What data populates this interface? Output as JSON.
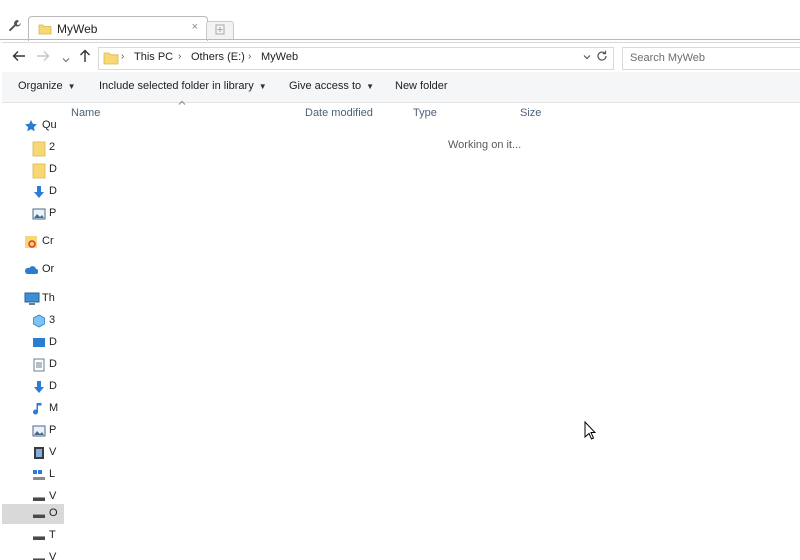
{
  "tab": {
    "title": "MyWeb",
    "close_glyph": "×"
  },
  "breadcrumb": {
    "items": [
      "This PC",
      "Others (E:)",
      "MyWeb"
    ]
  },
  "search": {
    "placeholder": "Search MyWeb"
  },
  "toolbar": {
    "organize": "Organize",
    "include_library": "Include selected folder in library",
    "give_access": "Give access to",
    "new_folder": "New folder"
  },
  "columns": [
    "Name",
    "Date modified",
    "Type",
    "Size"
  ],
  "status": {
    "working": "Working on it..."
  },
  "nav_pane": {
    "items": [
      {
        "label": "Qu",
        "icon": "star-icon"
      },
      {
        "label": "2",
        "icon": "folder-icon"
      },
      {
        "label": "D",
        "icon": "folder-icon"
      },
      {
        "label": "D",
        "icon": "download-icon"
      },
      {
        "label": "P",
        "icon": "pictures-icon"
      },
      {
        "label": "Cr",
        "icon": "creative-cloud-icon"
      },
      {
        "label": "Or",
        "icon": "onedrive-icon"
      },
      {
        "label": "Th",
        "icon": "this-pc-icon"
      },
      {
        "label": "3",
        "icon": "3d-objects-icon"
      },
      {
        "label": "D",
        "icon": "desktop-icon"
      },
      {
        "label": "D",
        "icon": "documents-icon"
      },
      {
        "label": "D",
        "icon": "download-icon"
      },
      {
        "label": "M",
        "icon": "music-icon"
      },
      {
        "label": "P",
        "icon": "pictures-icon"
      },
      {
        "label": "V",
        "icon": "videos-icon"
      },
      {
        "label": "L",
        "icon": "windows-drive-icon"
      },
      {
        "label": "V",
        "icon": "drive-icon"
      },
      {
        "label": "O",
        "icon": "drive-icon"
      },
      {
        "label": "T",
        "icon": "drive-icon"
      },
      {
        "label": "V",
        "icon": "drive-icon"
      }
    ]
  },
  "colors": {
    "accent": "#2b7cd3",
    "folder": "#f8d775",
    "selected": "#d9d9d9",
    "column_header": "#4c607a"
  }
}
